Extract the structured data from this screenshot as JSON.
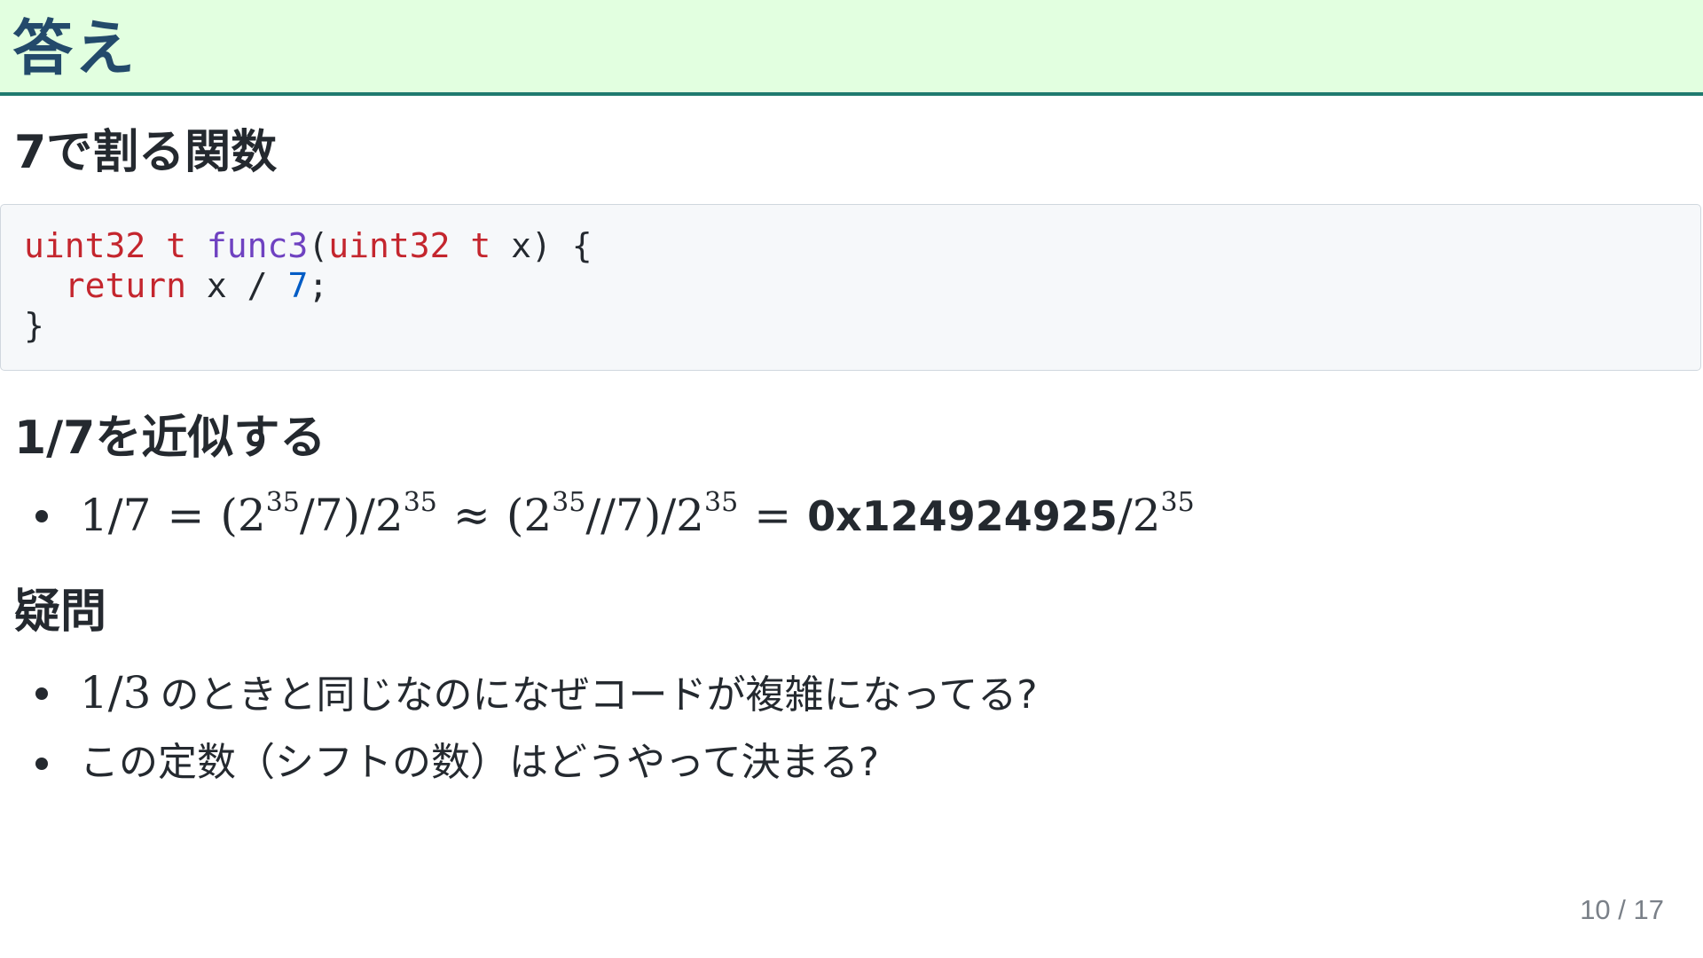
{
  "slide": {
    "title": "答え",
    "page_number": "10 / 17"
  },
  "sections": {
    "function": {
      "heading": "7で割る関数",
      "code": {
        "line1": {
          "t1": "uint32 t",
          "t2": " ",
          "t3": "func3",
          "t4": "(",
          "t5": "uint32 t",
          "t6": " x) {"
        },
        "line2": {
          "t1": "  ",
          "t2": "return",
          "t3": " x / ",
          "t4": "7",
          "t5": ";"
        },
        "line3": {
          "t1": "}"
        }
      }
    },
    "approx": {
      "heading": "1/7を近似する",
      "formula": {
        "p1": "1/7",
        "eq1": "=",
        "p2a": "(2",
        "p2sup": "35",
        "p2b": "/7)/2",
        "p2sup2": "35",
        "approx": "≈",
        "p3a": "(2",
        "p3sup": "35",
        "p3b": "//7)/2",
        "p3sup2": "35",
        "eq2": "=",
        "hex": "0x124924925",
        "p4a": "/2",
        "p4sup": "35"
      }
    },
    "question": {
      "heading": "疑問",
      "items": [
        {
          "math": "1/3",
          "text": "のときと同じなのになぜコードが複雑になってる?"
        },
        {
          "text": "この定数（シフトの数）はどうやって決まる?"
        }
      ]
    }
  }
}
